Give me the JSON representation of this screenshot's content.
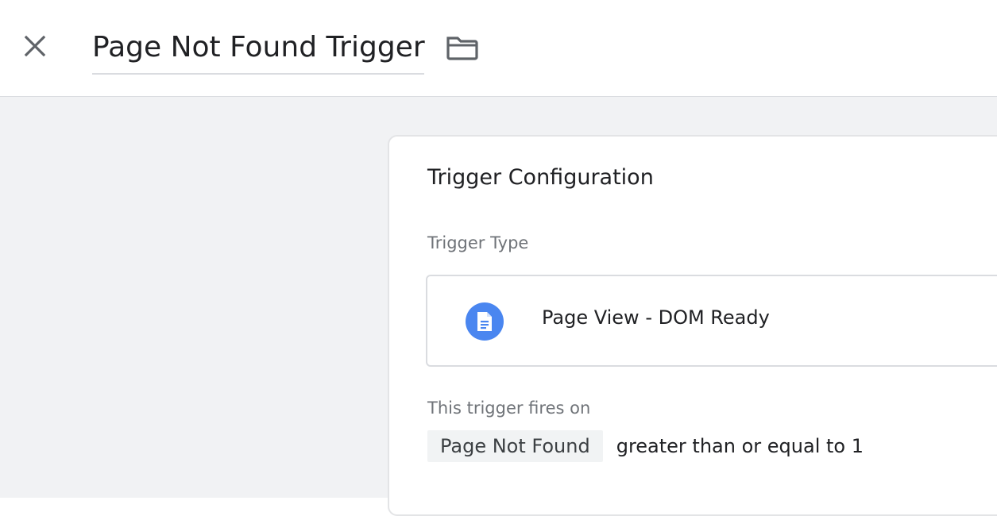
{
  "header": {
    "title": "Page Not Found Trigger",
    "close_icon": "close-icon",
    "folder_icon": "folder-icon"
  },
  "card": {
    "title": "Trigger Configuration",
    "trigger_type_label": "Trigger Type",
    "trigger_type": {
      "icon": "document-icon",
      "icon_color": "#4a86f0",
      "label": "Page View - DOM Ready"
    },
    "fires_on_label": "This trigger fires on",
    "condition": {
      "variable": "Page Not Found",
      "operator_value": "greater than or equal to 1"
    }
  },
  "colors": {
    "background": "#f1f2f4",
    "accent": "#4a86f0"
  }
}
